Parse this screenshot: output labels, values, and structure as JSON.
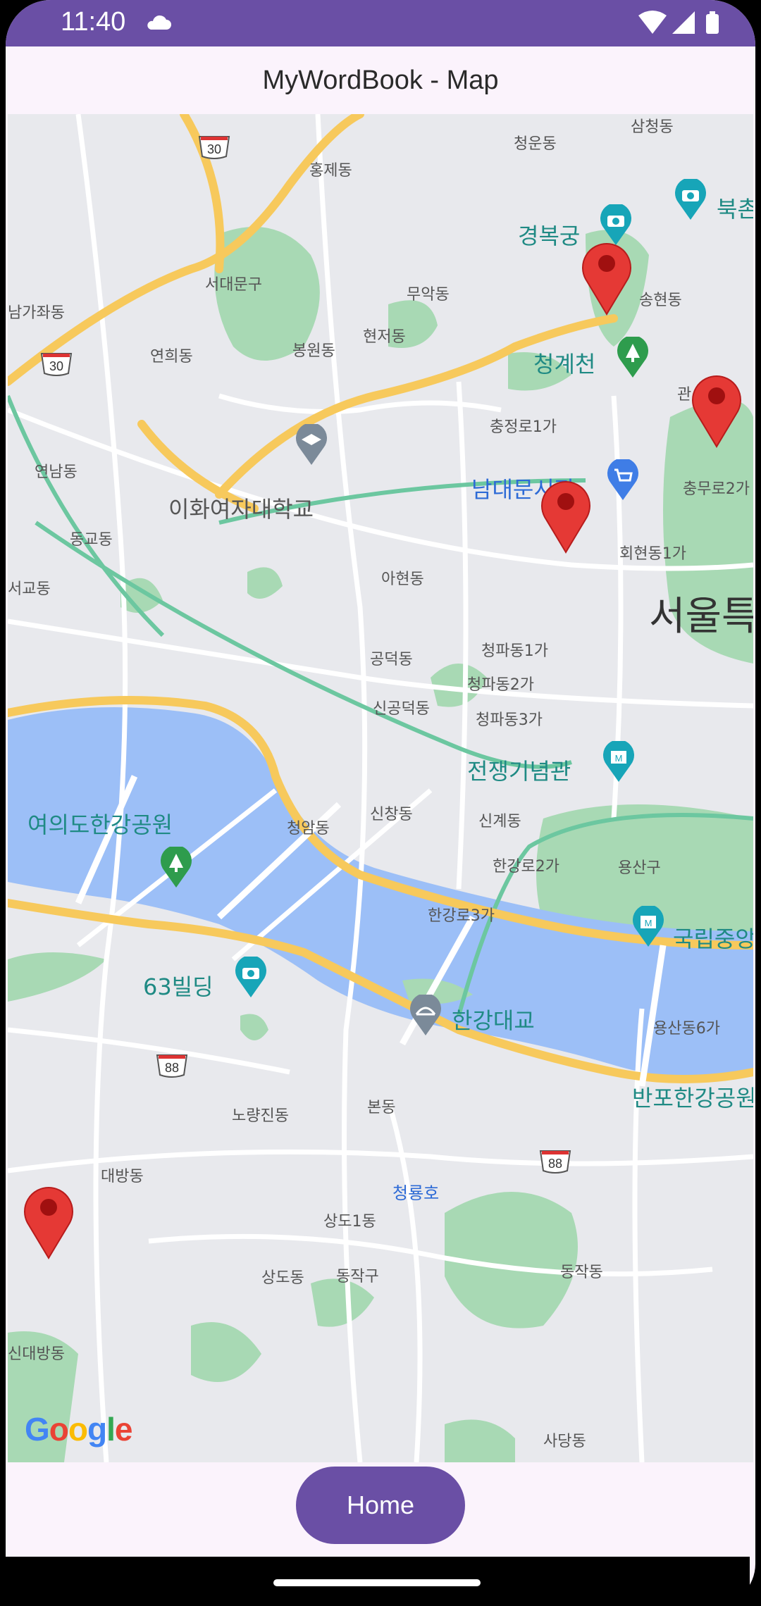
{
  "status_bar": {
    "time": "11:40",
    "icons": [
      "cloud-icon",
      "wifi-icon",
      "signal-icon",
      "battery-icon"
    ]
  },
  "app_bar": {
    "title": "MyWordBook - Map"
  },
  "map": {
    "colors": {
      "water": "#9cbff7",
      "park": "#a8d9b4",
      "road_major": "#f7c95c",
      "rail": "#6cc7a0",
      "land": "#e8e9ed"
    },
    "labels": {
      "samcheong": "삼청동",
      "cheongun": "청운동",
      "hongje": "홍제동",
      "gyeongbokgung": "경복궁",
      "bukchon": "북촌",
      "seodaemun": "서대문구",
      "muak": "무악동",
      "songhyeon": "송현동",
      "gajwa": "남가좌동",
      "yeonhui": "연희동",
      "bongwon": "봉원동",
      "hyeonjeo": "현저동",
      "cheonggyecheon": "청계천",
      "gwancheol": "관",
      "chungjeongro": "충정로1가",
      "yeonnam": "연남동",
      "ewha": "이화여자대학교",
      "namdaemun": "남대문시장",
      "chungmuro": "충무로2가",
      "donggyo": "동교동",
      "hoehyeon": "회현동1가",
      "ahyeon": "아현동",
      "seogyo": "서교동",
      "seoul": "서울특",
      "gongdeok": "공덕동",
      "cheongpa1": "청파동1가",
      "cheongpa2": "청파동2가",
      "singongdeok": "신공덕동",
      "cheongpa3": "청파동3가",
      "yeouido_park": "여의도한강공원",
      "war_memorial": "전쟁기념관",
      "sinchang": "신창동",
      "singye": "신계동",
      "cheongam": "청암동",
      "hangangro2": "한강로2가",
      "yongsan": "용산구",
      "hangangro3": "한강로3가",
      "national_museum": "국립중앙",
      "building63": "63빌딩",
      "hangang_bridge": "한강대교",
      "yongsan6": "용산동6가",
      "banpo": "반포한강공원",
      "noryangjin": "노량진동",
      "bon": "본동",
      "daebang": "대방동",
      "cheongryongho": "청룡호",
      "sangdo1": "상도1동",
      "sangdo": "상도동",
      "dongjak_gu": "동작구",
      "dongjak": "동작동",
      "sindaebang": "신대방동",
      "sadang": "사당동",
      "route30a": "30",
      "route30b": "30",
      "route88a": "88",
      "route88b": "88"
    },
    "attribution": "Google"
  },
  "bottom": {
    "home_label": "Home"
  }
}
